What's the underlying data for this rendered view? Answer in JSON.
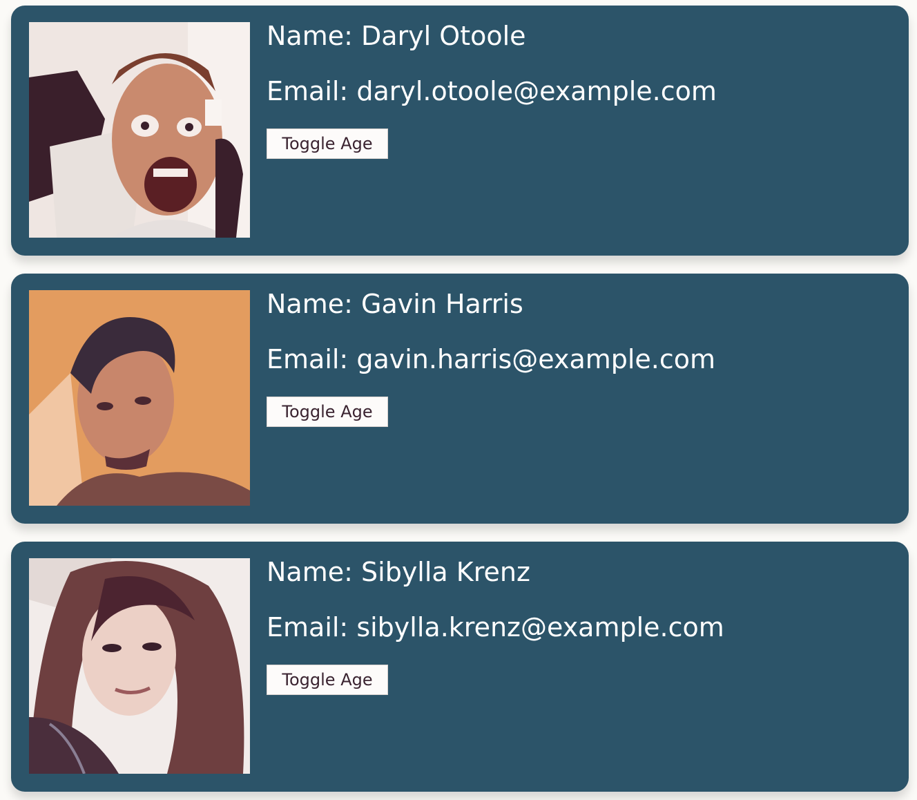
{
  "users": [
    {
      "name_label": "Name:",
      "name": "Daryl Otoole",
      "email_label": "Email:",
      "email": "daryl.otoole@example.com",
      "button_label": "Toggle Age"
    },
    {
      "name_label": "Name:",
      "name": "Gavin Harris",
      "email_label": "Email:",
      "email": "gavin.harris@example.com",
      "button_label": "Toggle Age"
    },
    {
      "name_label": "Name:",
      "name": "Sibylla Krenz",
      "email_label": "Email:",
      "email": "sibylla.krenz@example.com",
      "button_label": "Toggle Age"
    }
  ],
  "colors": {
    "card_background": "#2c5469",
    "page_background": "#fbfaf7",
    "text": "#ffffff",
    "button_background": "#fdfbfa",
    "button_text": "#3a2330"
  }
}
